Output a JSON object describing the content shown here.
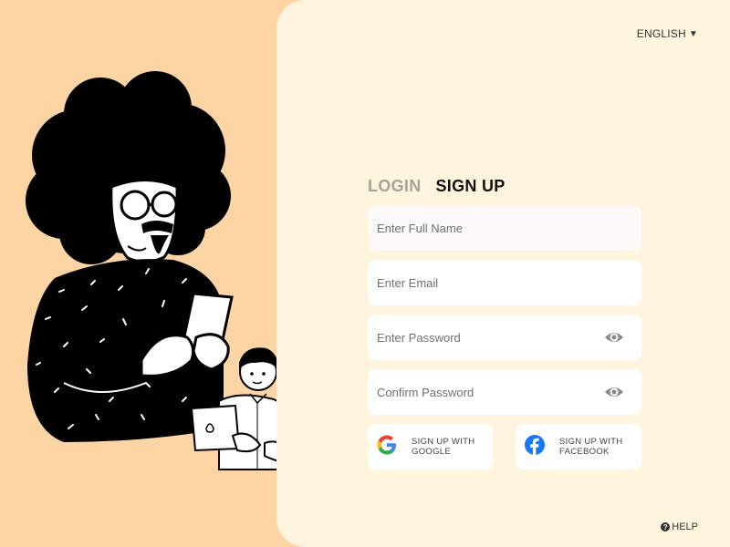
{
  "language": {
    "label": "ENGLISH",
    "caret": "▼",
    "icon": "caret-down-icon"
  },
  "tabs": [
    {
      "label": "LOGIN",
      "active": false
    },
    {
      "label": "SIGN UP",
      "active": true
    }
  ],
  "form": {
    "full_name": {
      "placeholder": "Enter Full Name",
      "value": ""
    },
    "email": {
      "placeholder": "Enter Email",
      "value": ""
    },
    "password": {
      "placeholder": "Enter Password",
      "value": "",
      "icon": "eye-icon"
    },
    "confirm_password": {
      "placeholder": "Confirm Password",
      "value": "",
      "icon": "eye-icon"
    }
  },
  "social": {
    "google": {
      "line1": "SIGN UP WITH",
      "line2": "GOOGLE",
      "icon": "google-icon"
    },
    "facebook": {
      "line1": "SIGN UP WITH",
      "line2": "FACEBOOK",
      "icon": "facebook-icon",
      "color": "#1877f2"
    }
  },
  "help": {
    "label": "HELP",
    "icon": "help-icon"
  },
  "colors": {
    "left_background": "#fdd5a4",
    "panel_background": "#fff4de",
    "active_tab": "#111111",
    "inactive_tab": "#a7a19a"
  }
}
